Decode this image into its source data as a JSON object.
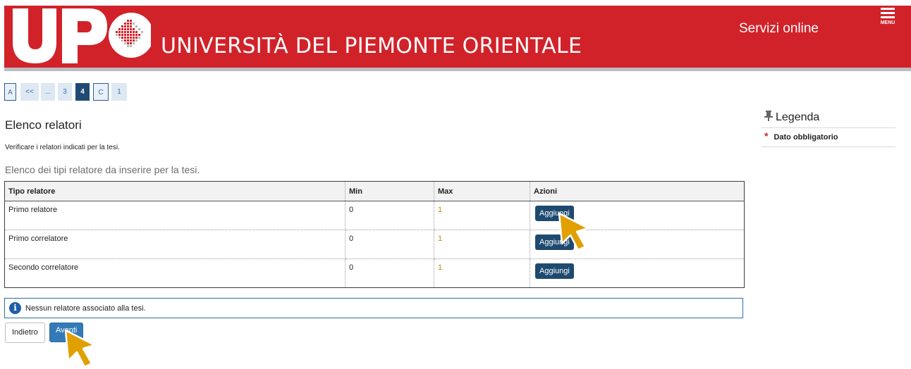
{
  "header": {
    "logo_text": "UPO",
    "university_name": "UNIVERSITÀ DEL PIEMONTE ORIENTALE",
    "services_label": "Servizi online",
    "menu_label": "MENU",
    "brand_color": "#d1222a"
  },
  "steps": [
    {
      "label": "A"
    },
    {
      "label": "<<"
    },
    {
      "label": "..."
    },
    {
      "label": "3"
    },
    {
      "label": "4"
    },
    {
      "label": "C"
    },
    {
      "label": "1"
    }
  ],
  "page": {
    "title": "Elenco relatori",
    "subtitle": "Verificare i relatori indicati per la tesi.",
    "section_caption": "Elenco dei tipi relatore da inserire per la tesi."
  },
  "table": {
    "headers": [
      "Tipo relatore",
      "Min",
      "Max",
      "Azioni"
    ],
    "rows": [
      {
        "tipo": "Primo relatore",
        "min": "0",
        "max": "1",
        "action": "Aggiungi"
      },
      {
        "tipo": "Primo correlatore",
        "min": "0",
        "max": "1",
        "action": "Aggiungi"
      },
      {
        "tipo": "Secondo correlatore",
        "min": "0",
        "max": "1",
        "action": "Aggiungi"
      }
    ]
  },
  "info": {
    "icon": "info-icon",
    "message": "Nessun relatore associato alla tesi."
  },
  "buttons": {
    "back_label": "Indietro",
    "next_label": "Avanti"
  },
  "legend": {
    "title": "Legenda",
    "items": [
      {
        "symbol": "*",
        "label": "Dato obbligatorio"
      }
    ]
  }
}
